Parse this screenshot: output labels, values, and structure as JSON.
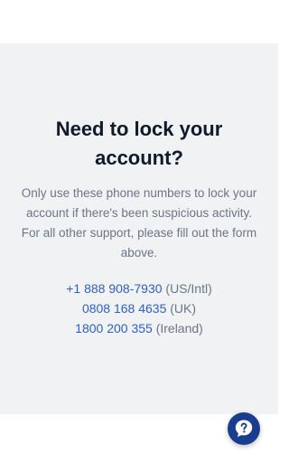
{
  "lock_section": {
    "heading_line1": "Need to lock your",
    "heading_line2": "account?",
    "description_line1": "Only use these phone numbers to lock your",
    "description_line2": "account if there's been suspicious activity.",
    "description_line3": "For all other support, please fill out the form",
    "description_line4": "above.",
    "phones": [
      {
        "number": "+1 888 908-7930",
        "region": "(US/Intl)"
      },
      {
        "number": "0808 168 4635",
        "region": "(UK)"
      },
      {
        "number": "1800 200 355",
        "region": "(Ireland)"
      }
    ]
  },
  "help_widget": {
    "icon": "help-chat-icon",
    "color": "#1a3d8f"
  },
  "colors": {
    "panel_bg": "#f1f2f4",
    "heading": "#0f1a2b",
    "body_text": "#6b7686",
    "link": "#2f5fc4"
  }
}
